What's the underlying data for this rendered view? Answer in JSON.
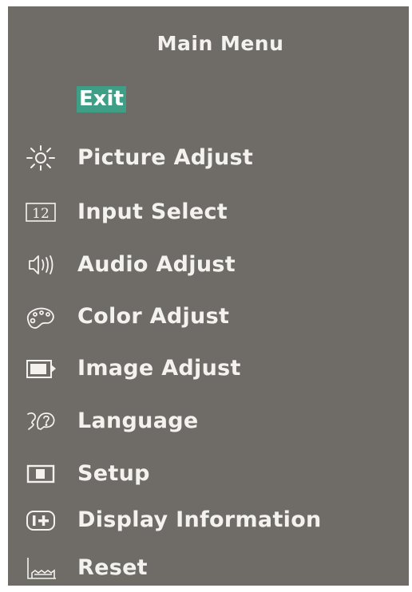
{
  "menu": {
    "title": "Main Menu",
    "exit_label": "Exit",
    "selected_color": "#3f9e86",
    "items": [
      {
        "label": "Picture Adjust",
        "icon": "sun-icon"
      },
      {
        "label": "Input Select",
        "icon": "input-select-icon"
      },
      {
        "label": "Audio Adjust",
        "icon": "speaker-icon"
      },
      {
        "label": "Color Adjust",
        "icon": "palette-icon"
      },
      {
        "label": "Image Adjust",
        "icon": "image-adjust-icon"
      },
      {
        "label": "Language",
        "icon": "language-icon"
      },
      {
        "label": "Setup",
        "icon": "setup-icon"
      },
      {
        "label": "Display Information",
        "icon": "info-icon"
      },
      {
        "label": "Reset",
        "icon": "reset-icon"
      }
    ]
  }
}
